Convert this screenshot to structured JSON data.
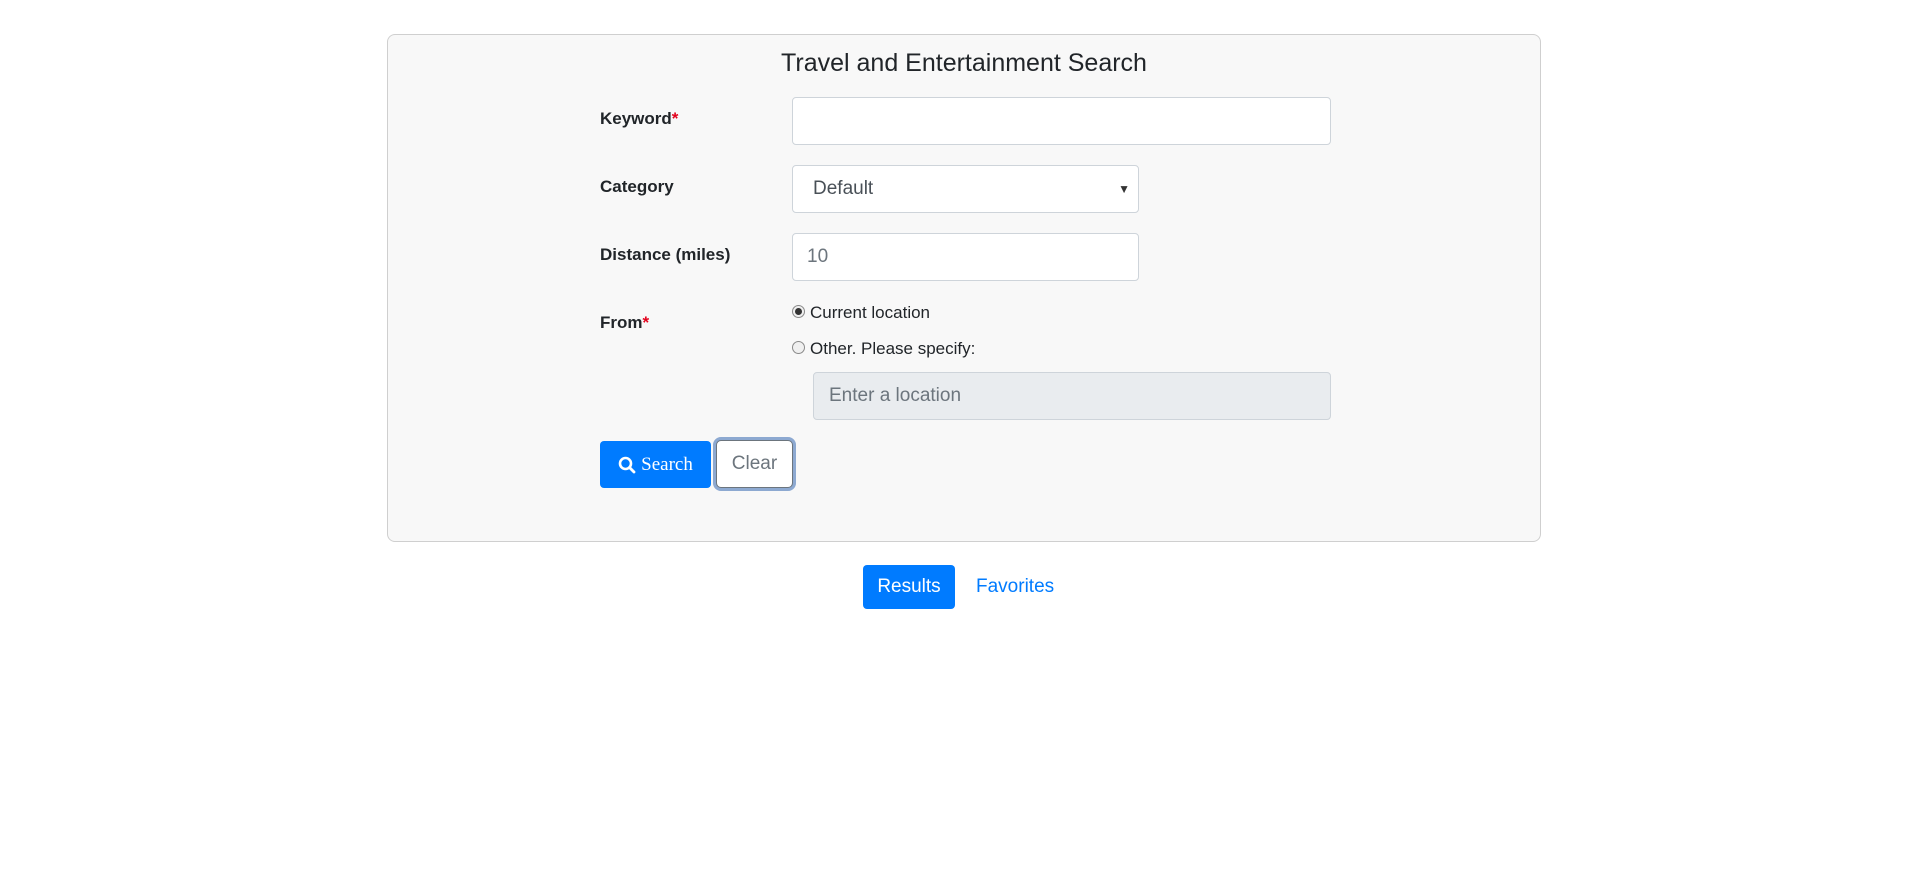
{
  "title": "Travel and Entertainment Search",
  "form": {
    "keyword_label": "Keyword",
    "required_mark": "*",
    "keyword_value": "",
    "category_label": "Category",
    "category_selected": "Default",
    "distance_label": "Distance (miles)",
    "distance_value": "10",
    "from_label": "From",
    "from_options": [
      "Current location",
      "Other. Please specify:"
    ],
    "from_selected": "Current location",
    "location_placeholder": "Enter a location"
  },
  "buttons": {
    "search_label": "Search",
    "clear_label": "Clear"
  },
  "tabs": {
    "results_label": "Results",
    "favorites_label": "Favorites",
    "active": "Results"
  },
  "colors": {
    "primary": "#007bff",
    "required": "#e3001b",
    "panel_bg": "#f8f8f8"
  },
  "icons": {
    "search_button_icon": "search-icon",
    "select_caret": "chevron-down-icon"
  }
}
